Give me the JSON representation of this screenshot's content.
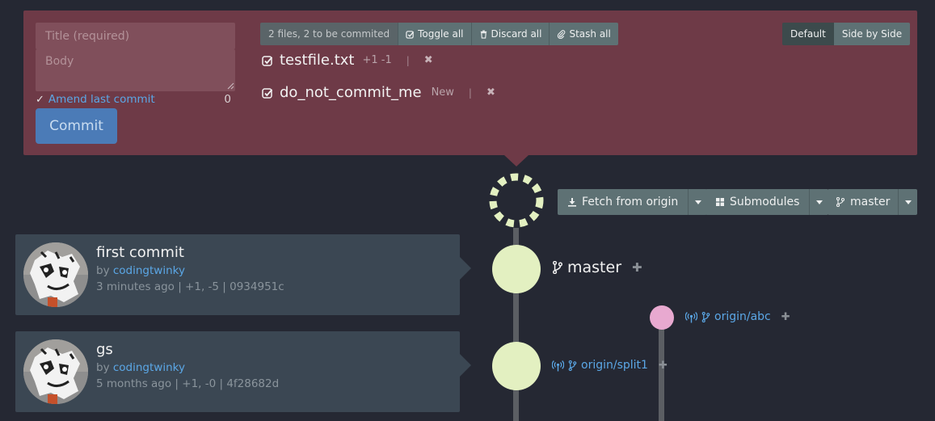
{
  "staging": {
    "title_placeholder": "Title (required)",
    "body_placeholder": "Body",
    "amend_label": "Amend last commit",
    "char_count": "0",
    "commit_label": "Commit",
    "files_info": "2 files, 2 to be commited",
    "toggle_all": "Toggle all",
    "discard_all": "Discard all",
    "stash_all": "Stash all",
    "view_default": "Default",
    "view_side_by_side": "Side by Side",
    "files": [
      {
        "name": "testfile.txt",
        "status": "+1 -1"
      },
      {
        "name": "do_not_commit_me",
        "status": "New"
      }
    ]
  },
  "toolbar": {
    "fetch_label": "Fetch from origin",
    "submodules_label": "Submodules",
    "branch_label": "master"
  },
  "commits": [
    {
      "title": "first commit",
      "by_prefix": "by",
      "author": "codingtwinky",
      "meta": "3 minutes ago | +1, -5 | 0934951c"
    },
    {
      "title": "gs",
      "by_prefix": "by",
      "author": "codingtwinky",
      "meta": "5 months ago | +1, -0 | 4f28682d"
    }
  ],
  "refs": {
    "master": "master",
    "origin_abc": "origin/abc",
    "origin_split1": "origin/split1"
  },
  "colors": {
    "staging_bg": "#6e3a47",
    "node_main": "#e3f0c1",
    "node_branch": "#e8a9d0",
    "link": "#5ba7e6",
    "commit_button": "#4b7bb7"
  }
}
